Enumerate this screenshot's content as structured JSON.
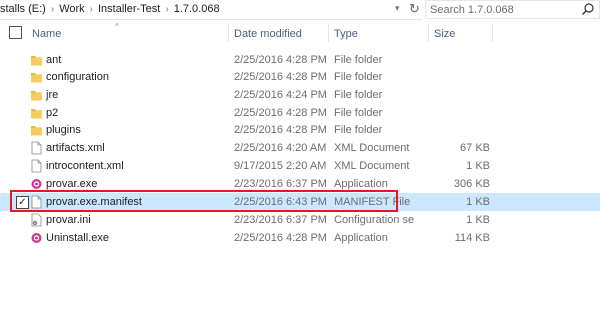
{
  "breadcrumb": {
    "segments": [
      "stalls (E:)",
      "Work",
      "Installer-Test",
      "1.7.0.068"
    ]
  },
  "search": {
    "placeholder": "Search 1.7.0.068"
  },
  "columns": {
    "name": "Name",
    "date": "Date modified",
    "type": "Type",
    "size": "Size"
  },
  "files": [
    {
      "name": "ant",
      "date": "2/25/2016 4:28 PM",
      "type": "File folder",
      "size": "",
      "icon": "folder-icon"
    },
    {
      "name": "configuration",
      "date": "2/25/2016 4:28 PM",
      "type": "File folder",
      "size": "",
      "icon": "folder-icon"
    },
    {
      "name": "jre",
      "date": "2/25/2016 4:24 PM",
      "type": "File folder",
      "size": "",
      "icon": "folder-icon"
    },
    {
      "name": "p2",
      "date": "2/25/2016 4:28 PM",
      "type": "File folder",
      "size": "",
      "icon": "folder-icon"
    },
    {
      "name": "plugins",
      "date": "2/25/2016 4:28 PM",
      "type": "File folder",
      "size": "",
      "icon": "folder-icon"
    },
    {
      "name": "artifacts.xml",
      "date": "2/25/2016 4:20 AM",
      "type": "XML Document",
      "size": "67 KB",
      "icon": "document-icon"
    },
    {
      "name": "introcontent.xml",
      "date": "9/17/2015 2:20 AM",
      "type": "XML Document",
      "size": "1 KB",
      "icon": "document-icon"
    },
    {
      "name": "provar.exe",
      "date": "2/23/2016 6:37 PM",
      "type": "Application",
      "size": "306 KB",
      "icon": "app-gear-icon"
    },
    {
      "name": "provar.exe.manifest",
      "date": "2/25/2016 6:43 PM",
      "type": "MANIFEST File",
      "size": "1 KB",
      "icon": "document-icon",
      "selected": true
    },
    {
      "name": "provar.ini",
      "date": "2/23/2016 6:37 PM",
      "type": "Configuration sett...",
      "size": "1 KB",
      "icon": "config-file-icon"
    },
    {
      "name": "Uninstall.exe",
      "date": "2/25/2016 4:28 PM",
      "type": "Application",
      "size": "114 KB",
      "icon": "app-gear-icon"
    }
  ],
  "colors": {
    "selection": "#cce8ff",
    "highlight_box": "#e01b24",
    "folder": "#e8b84a"
  }
}
